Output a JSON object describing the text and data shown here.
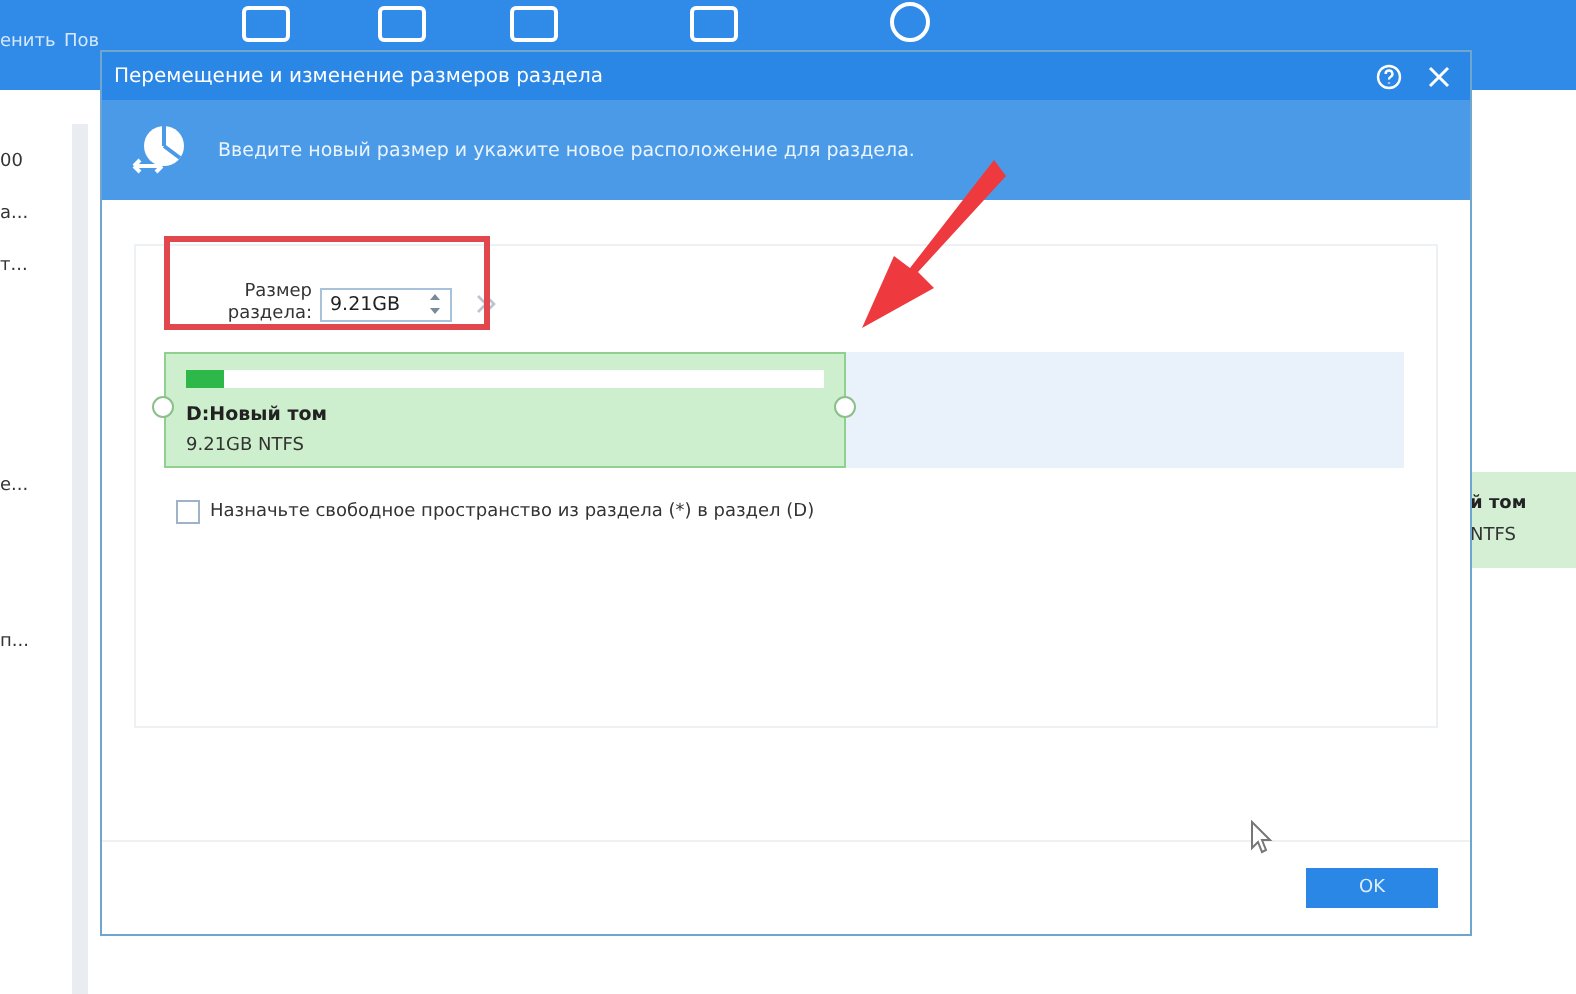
{
  "app": {
    "toolbar_labels": [
      "енить",
      "Пов"
    ],
    "sidebar_items": [
      "00",
      "а...",
      "т...",
      "е...",
      "п..."
    ],
    "right_card": {
      "name": "й том",
      "info": "NTFS"
    }
  },
  "dialog": {
    "title": "Перемещение и изменение размеров раздела",
    "header": "Введите новый размер и укажите новое расположение для раздела.",
    "size_label": "Размер раздела:",
    "size_value": "9.21GB",
    "partition": {
      "name": "D:Новый том",
      "info": "9.21GB NTFS",
      "level": 0.06
    },
    "checkbox": {
      "label": "Назначьте свободное пространство из раздела (*) в раздел (D)",
      "checked": false
    },
    "ok": "OK"
  }
}
